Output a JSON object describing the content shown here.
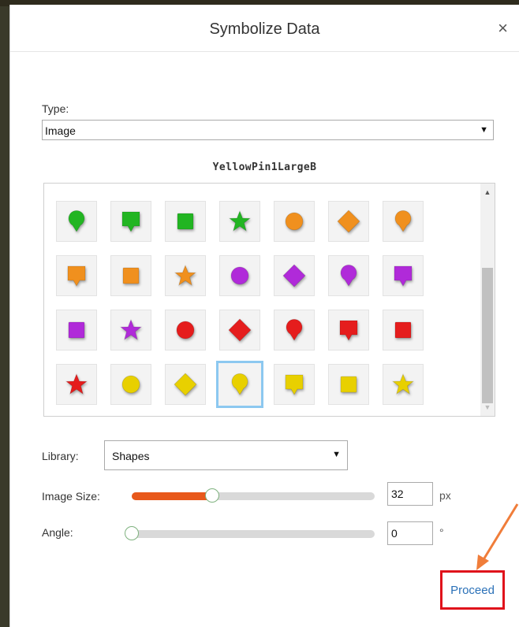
{
  "dialog": {
    "title": "Symbolize Data",
    "close_glyph": "×",
    "type_label": "Type:",
    "type_value": "Image",
    "selected_symbol": "YellowPin1LargeB",
    "library_label": "Library:",
    "library_value": "Shapes",
    "image_size_label": "Image Size:",
    "image_size_value": "32",
    "image_size_unit": "px",
    "image_size_slider_level": 0.33,
    "angle_label": "Angle:",
    "angle_value": "0",
    "angle_unit": "°",
    "angle_slider_level": 0,
    "proceed_label": "Proceed"
  },
  "select_arrow": "▼",
  "colors": {
    "green": "#22b522",
    "orange": "#f0901e",
    "purple": "#b02ad9",
    "red": "#e51d1d",
    "yellow": "#e8d000",
    "slider_fill": "#e8581b",
    "selected_border": "#8cc8f0",
    "highlight": "#e0121b",
    "annotation_arrow": "#f07d3a"
  },
  "symbols": [
    [
      "green-pin",
      "green-callout",
      "green-square",
      "green-star",
      "orange-circle",
      "orange-diamond",
      "orange-pin"
    ],
    [
      "orange-callout",
      "orange-square",
      "orange-star",
      "purple-circle",
      "purple-diamond",
      "purple-pin",
      "purple-callout"
    ],
    [
      "purple-square",
      "purple-star",
      "red-circle",
      "red-diamond",
      "red-pin",
      "red-callout",
      "red-square"
    ],
    [
      "red-star",
      "yellow-circle",
      "yellow-diamond",
      "yellow-pin",
      "yellow-callout",
      "yellow-square",
      "yellow-star"
    ]
  ],
  "selected_index": [
    3,
    3
  ]
}
